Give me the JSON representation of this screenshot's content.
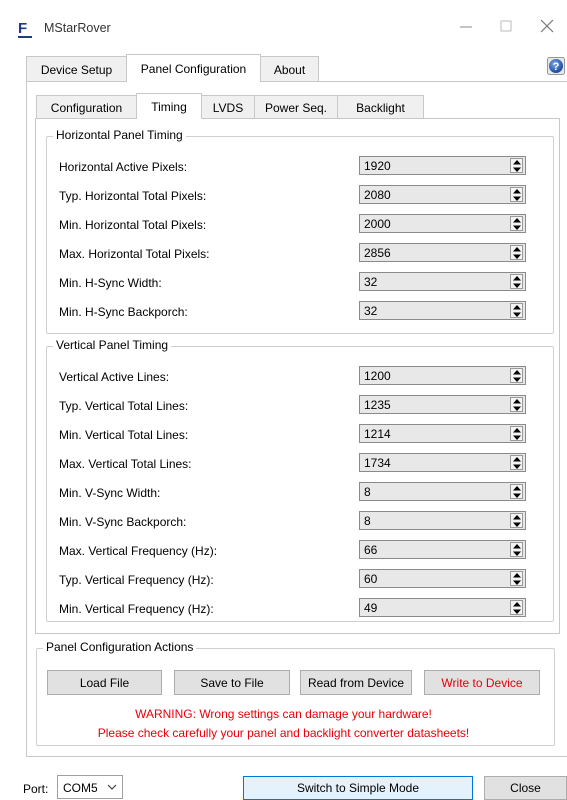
{
  "window": {
    "title": "MStarRover",
    "logo_letter": "F"
  },
  "outer_tabs": [
    {
      "label": "Device Setup",
      "active": false
    },
    {
      "label": "Panel Configuration",
      "active": true
    },
    {
      "label": "About",
      "active": false
    }
  ],
  "inner_tabs": [
    {
      "label": "Configuration",
      "active": false
    },
    {
      "label": "Timing",
      "active": true
    },
    {
      "label": "LVDS",
      "active": false
    },
    {
      "label": "Power Seq.",
      "active": false
    },
    {
      "label": "Backlight",
      "active": false
    }
  ],
  "horizontal": {
    "title": "Horizontal Panel Timing",
    "rows": [
      {
        "label": "Horizontal Active Pixels:",
        "value": "1920"
      },
      {
        "label": "Typ. Horizontal Total Pixels:",
        "value": "2080"
      },
      {
        "label": "Min. Horizontal Total Pixels:",
        "value": "2000"
      },
      {
        "label": "Max. Horizontal Total Pixels:",
        "value": "2856"
      },
      {
        "label": "Min. H-Sync Width:",
        "value": "32"
      },
      {
        "label": "Min. H-Sync Backporch:",
        "value": "32"
      }
    ]
  },
  "vertical": {
    "title": "Vertical Panel Timing",
    "rows": [
      {
        "label": "Vertical Active Lines:",
        "value": "1200"
      },
      {
        "label": "Typ. Vertical Total Lines:",
        "value": "1235"
      },
      {
        "label": "Min. Vertical Total Lines:",
        "value": "1214"
      },
      {
        "label": "Max. Vertical Total Lines:",
        "value": "1734"
      },
      {
        "label": "Min. V-Sync Width:",
        "value": "8"
      },
      {
        "label": "Min. V-Sync Backporch:",
        "value": "8"
      },
      {
        "label": "Max. Vertical Frequency (Hz):",
        "value": "66"
      },
      {
        "label": "Typ. Vertical Frequency (Hz):",
        "value": "60"
      },
      {
        "label": "Min. Vertical Frequency (Hz):",
        "value": "49"
      }
    ]
  },
  "actions": {
    "title": "Panel Configuration Actions",
    "load": "Load File",
    "save": "Save to File",
    "read": "Read from Device",
    "write": "Write to Device",
    "warning1": "WARNING: Wrong settings can damage your hardware!",
    "warning2": "Please check carefully your panel and backlight converter datasheets!"
  },
  "footer": {
    "port_label": "Port:",
    "port_value": "COM5",
    "simple_mode": "Switch to Simple Mode",
    "close": "Close"
  },
  "colors": {
    "warning": "#e8000b",
    "accent": "#0078d7",
    "logo": "#1f3c88"
  }
}
